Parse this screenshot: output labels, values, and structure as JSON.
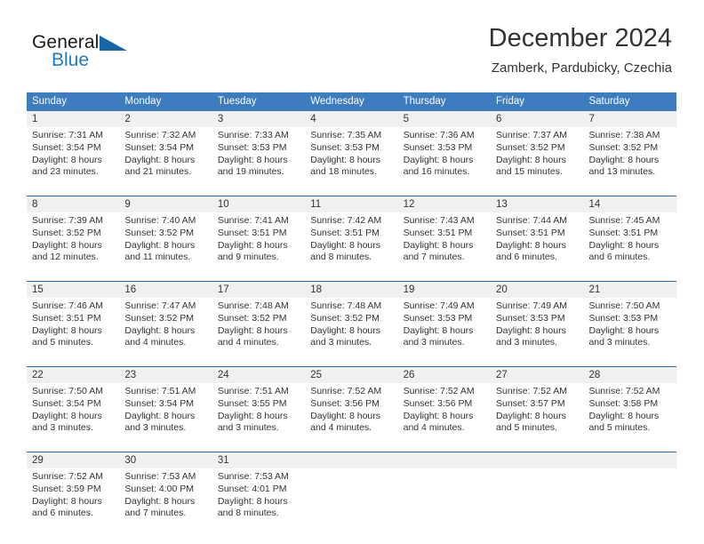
{
  "brand": {
    "line1": "General",
    "line2": "Blue",
    "accent_color": "#1d7ac4",
    "triangle_color": "#1565a8"
  },
  "header": {
    "title": "December 2024",
    "subtitle": "Zamberk, Pardubicky, Czechia"
  },
  "theme": {
    "header_row_bg": "#3c7cbf",
    "header_row_text": "#ffffff",
    "daynum_band_bg": "#f0f0f0",
    "week_separator": "#2e6ba8",
    "text": "#333333"
  },
  "weekdays": [
    "Sunday",
    "Monday",
    "Tuesday",
    "Wednesday",
    "Thursday",
    "Friday",
    "Saturday"
  ],
  "weeks": [
    [
      {
        "day": "1",
        "lines": [
          "Sunrise: 7:31 AM",
          "Sunset: 3:54 PM",
          "Daylight: 8 hours",
          "and 23 minutes."
        ]
      },
      {
        "day": "2",
        "lines": [
          "Sunrise: 7:32 AM",
          "Sunset: 3:54 PM",
          "Daylight: 8 hours",
          "and 21 minutes."
        ]
      },
      {
        "day": "3",
        "lines": [
          "Sunrise: 7:33 AM",
          "Sunset: 3:53 PM",
          "Daylight: 8 hours",
          "and 19 minutes."
        ]
      },
      {
        "day": "4",
        "lines": [
          "Sunrise: 7:35 AM",
          "Sunset: 3:53 PM",
          "Daylight: 8 hours",
          "and 18 minutes."
        ]
      },
      {
        "day": "5",
        "lines": [
          "Sunrise: 7:36 AM",
          "Sunset: 3:53 PM",
          "Daylight: 8 hours",
          "and 16 minutes."
        ]
      },
      {
        "day": "6",
        "lines": [
          "Sunrise: 7:37 AM",
          "Sunset: 3:52 PM",
          "Daylight: 8 hours",
          "and 15 minutes."
        ]
      },
      {
        "day": "7",
        "lines": [
          "Sunrise: 7:38 AM",
          "Sunset: 3:52 PM",
          "Daylight: 8 hours",
          "and 13 minutes."
        ]
      }
    ],
    [
      {
        "day": "8",
        "lines": [
          "Sunrise: 7:39 AM",
          "Sunset: 3:52 PM",
          "Daylight: 8 hours",
          "and 12 minutes."
        ]
      },
      {
        "day": "9",
        "lines": [
          "Sunrise: 7:40 AM",
          "Sunset: 3:52 PM",
          "Daylight: 8 hours",
          "and 11 minutes."
        ]
      },
      {
        "day": "10",
        "lines": [
          "Sunrise: 7:41 AM",
          "Sunset: 3:51 PM",
          "Daylight: 8 hours",
          "and 9 minutes."
        ]
      },
      {
        "day": "11",
        "lines": [
          "Sunrise: 7:42 AM",
          "Sunset: 3:51 PM",
          "Daylight: 8 hours",
          "and 8 minutes."
        ]
      },
      {
        "day": "12",
        "lines": [
          "Sunrise: 7:43 AM",
          "Sunset: 3:51 PM",
          "Daylight: 8 hours",
          "and 7 minutes."
        ]
      },
      {
        "day": "13",
        "lines": [
          "Sunrise: 7:44 AM",
          "Sunset: 3:51 PM",
          "Daylight: 8 hours",
          "and 6 minutes."
        ]
      },
      {
        "day": "14",
        "lines": [
          "Sunrise: 7:45 AM",
          "Sunset: 3:51 PM",
          "Daylight: 8 hours",
          "and 6 minutes."
        ]
      }
    ],
    [
      {
        "day": "15",
        "lines": [
          "Sunrise: 7:46 AM",
          "Sunset: 3:51 PM",
          "Daylight: 8 hours",
          "and 5 minutes."
        ]
      },
      {
        "day": "16",
        "lines": [
          "Sunrise: 7:47 AM",
          "Sunset: 3:52 PM",
          "Daylight: 8 hours",
          "and 4 minutes."
        ]
      },
      {
        "day": "17",
        "lines": [
          "Sunrise: 7:48 AM",
          "Sunset: 3:52 PM",
          "Daylight: 8 hours",
          "and 4 minutes."
        ]
      },
      {
        "day": "18",
        "lines": [
          "Sunrise: 7:48 AM",
          "Sunset: 3:52 PM",
          "Daylight: 8 hours",
          "and 3 minutes."
        ]
      },
      {
        "day": "19",
        "lines": [
          "Sunrise: 7:49 AM",
          "Sunset: 3:53 PM",
          "Daylight: 8 hours",
          "and 3 minutes."
        ]
      },
      {
        "day": "20",
        "lines": [
          "Sunrise: 7:49 AM",
          "Sunset: 3:53 PM",
          "Daylight: 8 hours",
          "and 3 minutes."
        ]
      },
      {
        "day": "21",
        "lines": [
          "Sunrise: 7:50 AM",
          "Sunset: 3:53 PM",
          "Daylight: 8 hours",
          "and 3 minutes."
        ]
      }
    ],
    [
      {
        "day": "22",
        "lines": [
          "Sunrise: 7:50 AM",
          "Sunset: 3:54 PM",
          "Daylight: 8 hours",
          "and 3 minutes."
        ]
      },
      {
        "day": "23",
        "lines": [
          "Sunrise: 7:51 AM",
          "Sunset: 3:54 PM",
          "Daylight: 8 hours",
          "and 3 minutes."
        ]
      },
      {
        "day": "24",
        "lines": [
          "Sunrise: 7:51 AM",
          "Sunset: 3:55 PM",
          "Daylight: 8 hours",
          "and 3 minutes."
        ]
      },
      {
        "day": "25",
        "lines": [
          "Sunrise: 7:52 AM",
          "Sunset: 3:56 PM",
          "Daylight: 8 hours",
          "and 4 minutes."
        ]
      },
      {
        "day": "26",
        "lines": [
          "Sunrise: 7:52 AM",
          "Sunset: 3:56 PM",
          "Daylight: 8 hours",
          "and 4 minutes."
        ]
      },
      {
        "day": "27",
        "lines": [
          "Sunrise: 7:52 AM",
          "Sunset: 3:57 PM",
          "Daylight: 8 hours",
          "and 5 minutes."
        ]
      },
      {
        "day": "28",
        "lines": [
          "Sunrise: 7:52 AM",
          "Sunset: 3:58 PM",
          "Daylight: 8 hours",
          "and 5 minutes."
        ]
      }
    ],
    [
      {
        "day": "29",
        "lines": [
          "Sunrise: 7:52 AM",
          "Sunset: 3:59 PM",
          "Daylight: 8 hours",
          "and 6 minutes."
        ]
      },
      {
        "day": "30",
        "lines": [
          "Sunrise: 7:53 AM",
          "Sunset: 4:00 PM",
          "Daylight: 8 hours",
          "and 7 minutes."
        ]
      },
      {
        "day": "31",
        "lines": [
          "Sunrise: 7:53 AM",
          "Sunset: 4:01 PM",
          "Daylight: 8 hours",
          "and 8 minutes."
        ]
      },
      {
        "day": "",
        "lines": []
      },
      {
        "day": "",
        "lines": []
      },
      {
        "day": "",
        "lines": []
      },
      {
        "day": "",
        "lines": []
      }
    ]
  ]
}
